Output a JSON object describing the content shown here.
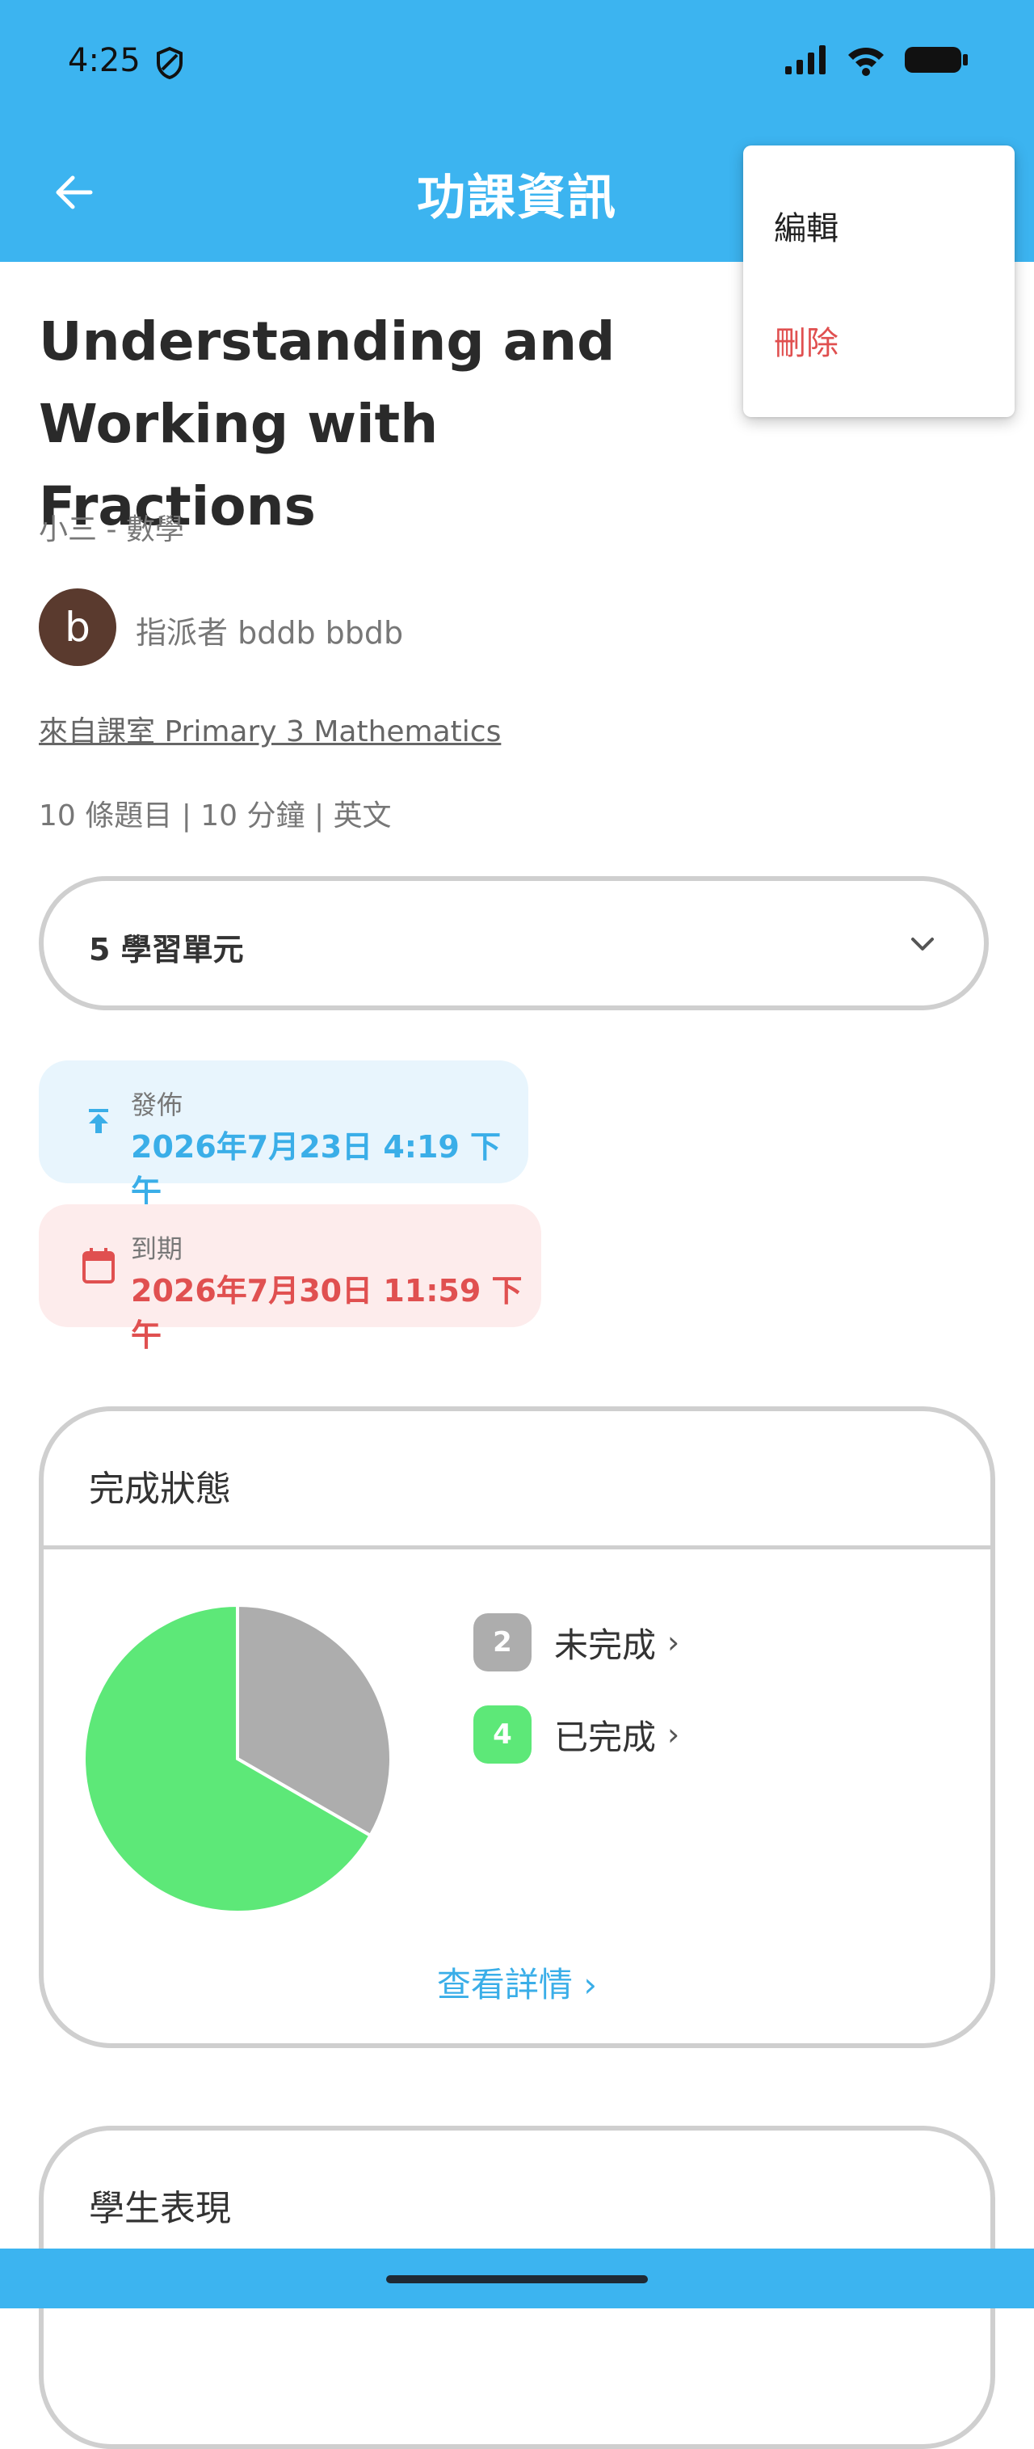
{
  "status_bar": {
    "time": "4:25",
    "icons": [
      "shield-icon",
      "signal-icon",
      "wifi-icon",
      "battery-icon"
    ]
  },
  "app_bar": {
    "title": "功課資訊",
    "back_icon": "back-arrow-icon"
  },
  "menu": {
    "edit_label": "編輯",
    "delete_label": "刪除"
  },
  "homework": {
    "title": "Understanding and Working with Fractions",
    "grade_subject": "小三 - 數學",
    "avatar_letter": "b",
    "assigner": "指派者 bddb bbdb",
    "classroom": "來自課室 Primary 3 Mathematics",
    "stats": "10 條題目 | 10 分鐘 | 英文"
  },
  "units": {
    "label": "5 學習單元"
  },
  "dates": {
    "publish_label": "發佈",
    "publish_value": "2026年7月23日 4:19 下午",
    "due_label": "到期",
    "due_value": "2026年7月30日 11:59 下午"
  },
  "completion": {
    "title": "完成狀態",
    "incomplete_count": "2",
    "incomplete_label": "未完成",
    "complete_count": "4",
    "complete_label": "已完成",
    "details_link": "查看詳情 ›"
  },
  "chart_data": {
    "type": "pie",
    "categories": [
      "未完成",
      "已完成"
    ],
    "values": [
      2,
      4
    ],
    "colors": [
      "#adadad",
      "#5de878"
    ]
  },
  "performance": {
    "title": "學生表現"
  },
  "colors": {
    "primary": "#3cb4f0",
    "danger": "#e05050",
    "complete": "#5de878",
    "incomplete": "#adadad"
  }
}
